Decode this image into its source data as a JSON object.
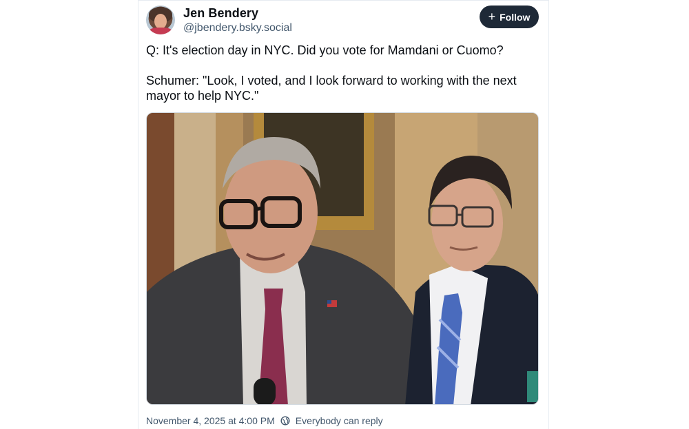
{
  "post": {
    "author": {
      "display_name": "Jen Bendery",
      "handle": "@jbendery.bsky.social"
    },
    "follow_button": {
      "label": "Follow",
      "icon": "plus-icon"
    },
    "text_paragraphs": [
      "Q: It's election day in NYC. Did you vote for Mamdani or Cuomo?",
      "Schumer: \"Look, I voted, and I look forward to working with the next mayor to help NYC.\""
    ],
    "timestamp": "November 4, 2025 at 4:00 PM",
    "reply_setting": "Everybody can reply",
    "reply_setting_icon": "globe-reply-icon"
  },
  "colors": {
    "follow_button_bg": "#1e2937",
    "secondary_text": "#42576c"
  }
}
